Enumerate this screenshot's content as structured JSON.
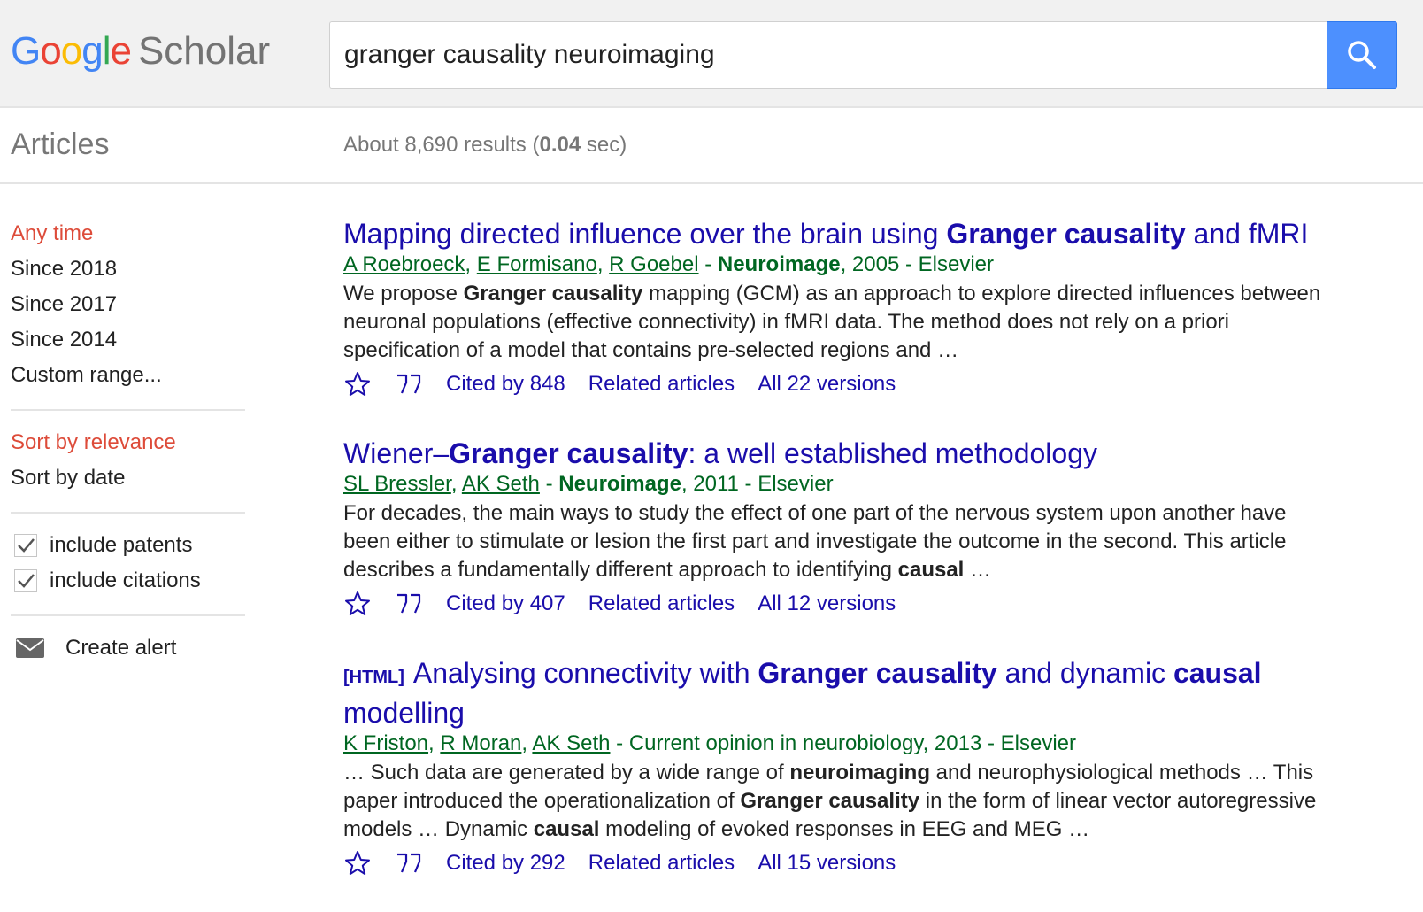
{
  "header": {
    "logo_google": [
      "G",
      "o",
      "o",
      "g",
      "l",
      "e"
    ],
    "logo_scholar": "Scholar",
    "search_value": "granger causality neuroimaging"
  },
  "subbar": {
    "section_label": "Articles",
    "stats_prefix": "About 8,690 results (",
    "stats_time": "0.04",
    "stats_suffix": " sec)"
  },
  "sidebar": {
    "time_filters": [
      "Any time",
      "Since 2018",
      "Since 2017",
      "Since 2014",
      "Custom range..."
    ],
    "sort_options": [
      "Sort by relevance",
      "Sort by date"
    ],
    "include_patents": "include patents",
    "include_citations": "include citations",
    "create_alert": "Create alert"
  },
  "results": [
    {
      "title_parts": [
        {
          "t": "Mapping directed influence over the brain using ",
          "b": false
        },
        {
          "t": "Granger causality",
          "b": true
        },
        {
          "t": " and fMRI",
          "b": false
        }
      ],
      "authors": [
        "A Roebroeck",
        "E Formisano",
        "R Goebel"
      ],
      "source_sep": " - ",
      "journal": "Neuroimage",
      "journal_bold": true,
      "year_publisher": ", 2005 - Elsevier",
      "snippet_parts": [
        {
          "t": "We propose ",
          "b": false
        },
        {
          "t": "Granger causality",
          "b": true
        },
        {
          "t": " mapping (GCM) as an approach to explore directed influences between neuronal populations (effective connectivity) in fMRI data. The method does not rely on a priori specification of a model that contains pre-selected regions and …",
          "b": false
        }
      ],
      "cited_by": "Cited by 848",
      "related": "Related articles",
      "versions": "All 22 versions"
    },
    {
      "title_parts": [
        {
          "t": "Wiener–",
          "b": false
        },
        {
          "t": "Granger causality",
          "b": true
        },
        {
          "t": ": a well established methodology",
          "b": false
        }
      ],
      "authors": [
        "SL Bressler",
        "AK Seth"
      ],
      "source_sep": " - ",
      "journal": "Neuroimage",
      "journal_bold": true,
      "year_publisher": ", 2011 - Elsevier",
      "snippet_parts": [
        {
          "t": "For decades, the main ways to study the effect of one part of the nervous system upon another have been either to stimulate or lesion the first part and investigate the outcome in the second. This article describes a fundamentally different approach to identifying ",
          "b": false
        },
        {
          "t": "causal",
          "b": true
        },
        {
          "t": "  …",
          "b": false
        }
      ],
      "cited_by": "Cited by 407",
      "related": "Related articles",
      "versions": "All 12 versions"
    },
    {
      "tag": "[HTML]",
      "title_parts": [
        {
          "t": "Analysing connectivity with ",
          "b": false
        },
        {
          "t": "Granger causality",
          "b": true
        },
        {
          "t": " and dynamic ",
          "b": false
        },
        {
          "t": "causal",
          "b": true
        },
        {
          "t": " modelling",
          "b": false
        }
      ],
      "authors": [
        "K Friston",
        "R Moran",
        "AK Seth"
      ],
      "source_sep": " - ",
      "journal": "Current opinion in neurobiology",
      "journal_bold": false,
      "year_publisher": ", 2013 - Elsevier",
      "snippet_parts": [
        {
          "t": "… Such data are generated by a wide range of ",
          "b": false
        },
        {
          "t": "neuroimaging",
          "b": true
        },
        {
          "t": " and neurophysiological methods … This paper introduced the operationalization of ",
          "b": false
        },
        {
          "t": "Granger causality",
          "b": true
        },
        {
          "t": " in the form of linear vector autoregressive models … Dynamic ",
          "b": false
        },
        {
          "t": "causal",
          "b": true
        },
        {
          "t": " modeling of evoked responses in EEG and MEG …",
          "b": false
        }
      ],
      "cited_by": "Cited by 292",
      "related": "Related articles",
      "versions": "All 15 versions"
    }
  ],
  "colors": {
    "link": "#1a0dab",
    "green": "#006621",
    "active": "#dd4b39",
    "search_button": "#4d90fe",
    "logo": [
      "#4285f4",
      "#ea4335",
      "#fbbc05",
      "#4285f4",
      "#34a853",
      "#ea4335"
    ]
  },
  "icons": {
    "search_button": "search-icon",
    "save": "star-icon",
    "cite": "quote-icon",
    "alert": "envelope-icon",
    "checkbox": "checkmark-icon"
  }
}
